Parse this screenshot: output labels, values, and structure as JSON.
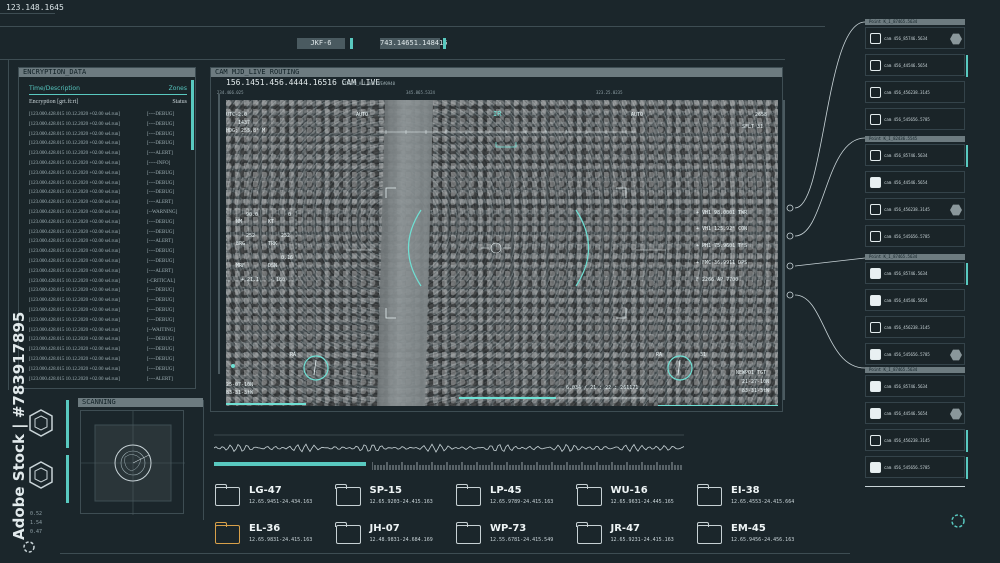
{
  "top_id": "123.148.1645",
  "top_readouts": {
    "code": "JKF-6",
    "value": "743.14651.148415"
  },
  "encryption": {
    "title": "ENCRYPTION_DATA",
    "col_left": "Time/Description",
    "col_right": "Zones",
    "sub_left": "Encryption [grt.ft:rt]",
    "sub_right": "Status",
    "rows": [
      {
        "text": "[123.000.428.015 10.12.2020 +02.00 sel.run]",
        "level": "[----DEBUG]"
      },
      {
        "text": "[123.000.428.015 10.12.2020 +02.00 sel.run]",
        "level": "[----DEBUG]"
      },
      {
        "text": "[123.000.428.015 10.12.2020 +02.00 sel.run]",
        "level": "[----DEBUG]"
      },
      {
        "text": "[123.000.428.015 10.12.2020 +02.00 sel.run]",
        "level": "[----DEBUG]"
      },
      {
        "text": "[123.000.428.015 10.12.2020 +02.00 sel.run]",
        "level": "[----ALERT]"
      },
      {
        "text": "[123.000.428.015 10.12.2020 +02.00 sel.run]",
        "level": "[-----INFO]"
      },
      {
        "text": "[123.000.428.015 10.12.2020 +02.00 sel.run]",
        "level": "[----DEBUG]"
      },
      {
        "text": "[123.000.428.015 10.12.2020 +02.00 sel.run]",
        "level": "[----DEBUG]"
      },
      {
        "text": "[123.000.428.015 10.12.2020 +02.00 sel.run]",
        "level": "[----DEBUG]"
      },
      {
        "text": "[123.000.428.015 10.12.2020 +02.00 sel.run]",
        "level": "[----ALERT]"
      },
      {
        "text": "[123.000.428.015 10.12.2020 +02.00 sel.run]",
        "level": "[--WARNING]"
      },
      {
        "text": "[123.000.428.015 10.12.2020 +02.00 sel.run]",
        "level": "[----DEBUG]"
      },
      {
        "text": "[123.000.428.015 10.12.2020 +02.00 sel.run]",
        "level": "[----DEBUG]"
      },
      {
        "text": "[123.000.428.015 10.12.2020 +02.00 sel.run]",
        "level": "[----ALERT]"
      },
      {
        "text": "[123.000.428.015 10.12.2020 +02.00 sel.run]",
        "level": "[----DEBUG]"
      },
      {
        "text": "[123.000.428.015 10.12.2020 +02.00 sel.run]",
        "level": "[----DEBUG]"
      },
      {
        "text": "[123.000.428.015 10.12.2020 +02.00 sel.run]",
        "level": "[----ALERT]"
      },
      {
        "text": "[123.000.428.015 10.12.2020 +02.00 sel.run]",
        "level": "[-CRITICAL]"
      },
      {
        "text": "[123.000.428.015 10.12.2020 +02.00 sel.run]",
        "level": "[----DEBUG]"
      },
      {
        "text": "[123.000.428.015 10.12.2020 +02.00 sel.run]",
        "level": "[----DEBUG]"
      },
      {
        "text": "[123.000.428.015 10.12.2020 +02.00 sel.run]",
        "level": "[----DEBUG]"
      },
      {
        "text": "[123.000.428.015 10.12.2020 +02.00 sel.run]",
        "level": "[----DEBUG]"
      },
      {
        "text": "[123.000.428.015 10.12.2020 +02.00 sel.run]",
        "level": "[--WAITING]"
      },
      {
        "text": "[123.000.428.015 10.12.2020 +02.00 sel.run]",
        "level": "[----DEBUG]"
      },
      {
        "text": "[123.000.428.015 10.12.2020 +02.00 sel.run]",
        "level": "[----DEBUG]"
      },
      {
        "text": "[123.000.428.015 10.12.2020 +02.00 sel.run]",
        "level": "[----DEBUG]"
      },
      {
        "text": "[123.000.428.015 10.12.2020 +02.00 sel.run]",
        "level": "[----DEBUG]"
      },
      {
        "text": "[123.000.428.015 10.12.2020 +02.00 sel.run]",
        "level": "[----ALERT]"
      }
    ]
  },
  "scanning": {
    "title": "SCANNING"
  },
  "left_numbers": [
    "0.52",
    "1.54",
    "0.47"
  ],
  "camera": {
    "title": "CAM MJD_LIVE ROUTING",
    "live_label": "156.1451.456.4444.16516 CAM LIVE",
    "stream_label": "STREAM_ALL_ACTIVE#0940",
    "coords_top": [
      "234.466.025",
      "345.865.5324",
      "323.25.0235"
    ],
    "hud": {
      "utc": "UTC-2.0",
      "alt": "1437",
      "hdg": "HDG:  255.8° M",
      "mode_left": "AUTO",
      "ir": "IR",
      "mode_right": "AUTO",
      "r_top": "2658",
      "r_sflt": "SFLT    31",
      "nm_val": "90.0",
      "nm_label": "NM",
      "kt_val": "0",
      "kt_label": "KT",
      "brg_val": "252",
      "brg_label": "BRG",
      "trk_val": "252",
      "trk_label": "TRK",
      "mrf": "MRF",
      "dsn": "DSN",
      "dsn_val": "0.16",
      "plus": "+ 21.1",
      "minus": "- 180",
      "r1": "+ VH1  98.0001  TWR",
      "r2": "+ VH1  125.92°  CON",
      "r3": "+ PH1  75.9601  TFS",
      "r4": "+ FMC  36.9911  DPS",
      "r5": "F   2266   AP   7700",
      "bl_lat": "25-07-10N",
      "bl_lon": "83-31-3tW",
      "center_readout": "6.034 / 21 : 22 : 261171",
      "newpoi": "NEWPOI TGT",
      "br_lat": "21-27-10N",
      "br_lon": "83-31-3tW",
      "ra_left": "RA",
      "ra_right": "RA",
      "n_right": "31"
    }
  },
  "waypoints": [
    {
      "name": "LG-47",
      "coords": "12.65.9451-24.434.163",
      "active": false
    },
    {
      "name": "SP-15",
      "coords": "12.65.9203-24.415.163",
      "active": false
    },
    {
      "name": "LP-45",
      "coords": "12.65.9789-24.415.163",
      "active": false
    },
    {
      "name": "WU-16",
      "coords": "12.65.9631-24.445.165",
      "active": false
    },
    {
      "name": "EI-38",
      "coords": "12.65.4553-24.415.664",
      "active": false
    },
    {
      "name": "EL-36",
      "coords": "12.65.9831-24.415.163",
      "active": true
    },
    {
      "name": "JH-07",
      "coords": "12.48.9831-24.684.169",
      "active": false
    },
    {
      "name": "WP-73",
      "coords": "12.55.6781-24.415.549",
      "active": false
    },
    {
      "name": "JR-47",
      "coords": "12.65.9231-24.415.163",
      "active": false
    },
    {
      "name": "EM-45",
      "coords": "12.65.9456-24.456.163",
      "active": false
    }
  ],
  "right_groups": [
    {
      "header": "Point K_I_87465.5634",
      "cards": [
        {
          "label": "cam 456_85746.5634",
          "checked": false,
          "hex": true,
          "side": false
        },
        {
          "label": "cam 456_44546.5654",
          "checked": false,
          "hex": false,
          "side": true
        },
        {
          "label": "cam 456_456238.3145",
          "checked": false,
          "hex": false,
          "side": false
        },
        {
          "label": "cam 456_545656.5785",
          "checked": false,
          "hex": false,
          "side": false
        }
      ]
    },
    {
      "header": "Point K_I_82436.5545",
      "cards": [
        {
          "label": "cam 456_85746.5634",
          "checked": false,
          "hex": false,
          "side": true
        },
        {
          "label": "cam 456_44546.5654",
          "checked": true,
          "hex": false,
          "side": false
        },
        {
          "label": "cam 456_456238.3145",
          "checked": false,
          "hex": true,
          "side": false
        },
        {
          "label": "cam 456_545656.5785",
          "checked": false,
          "hex": false,
          "side": false
        }
      ]
    },
    {
      "header": "Point K_I_87465.5634",
      "cards": [
        {
          "label": "cam 456_85746.5634",
          "checked": true,
          "hex": false,
          "side": true
        },
        {
          "label": "cam 456_44546.5654",
          "checked": true,
          "hex": false,
          "side": false
        },
        {
          "label": "cam 456_456238.3145",
          "checked": false,
          "hex": false,
          "side": false
        },
        {
          "label": "cam 456_545656.5785",
          "checked": true,
          "hex": true,
          "side": false
        }
      ]
    },
    {
      "header": "Point K_I_87465.5634",
      "cards": [
        {
          "label": "cam 456_85746.5634",
          "checked": true,
          "hex": false,
          "side": false
        },
        {
          "label": "cam 456_44546.5654",
          "checked": true,
          "hex": true,
          "side": false
        },
        {
          "label": "cam 456_456238.3145",
          "checked": false,
          "hex": false,
          "side": true
        },
        {
          "label": "cam 456_545656.5785",
          "checked": true,
          "hex": false,
          "side": true
        }
      ]
    }
  ],
  "watermark": "Adobe Stock | #783917895",
  "colors": {
    "accent": "#59c9c0",
    "background": "#1b262b",
    "active_folder": "#d7a04a"
  }
}
